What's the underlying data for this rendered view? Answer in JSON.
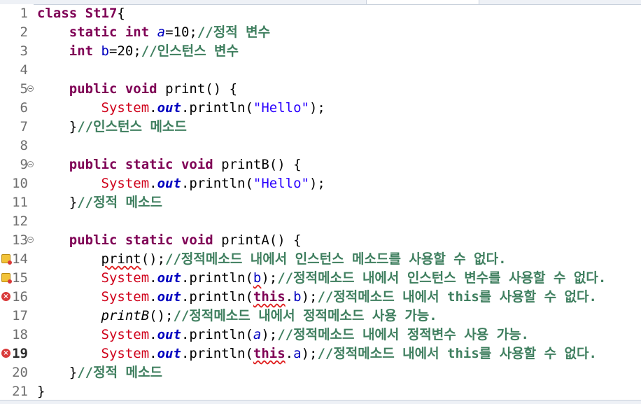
{
  "colors": {
    "keyword": "#7f0055",
    "string": "#2a00ff",
    "comment": "#3f7f5f",
    "system_class": "#d0021b",
    "static_field": "#0000c0",
    "error_marker": "#d93a3a",
    "warning_marker": "#f2c339"
  },
  "gutter": [
    {
      "num": "1",
      "marker": "",
      "fold": false
    },
    {
      "num": "2",
      "marker": "",
      "fold": false
    },
    {
      "num": "3",
      "marker": "",
      "fold": false
    },
    {
      "num": "4",
      "marker": "",
      "fold": false
    },
    {
      "num": "5",
      "marker": "",
      "fold": true
    },
    {
      "num": "6",
      "marker": "",
      "fold": false
    },
    {
      "num": "7",
      "marker": "",
      "fold": false
    },
    {
      "num": "8",
      "marker": "",
      "fold": false
    },
    {
      "num": "9",
      "marker": "",
      "fold": true
    },
    {
      "num": "10",
      "marker": "",
      "fold": false
    },
    {
      "num": "11",
      "marker": "",
      "fold": false
    },
    {
      "num": "12",
      "marker": "",
      "fold": false
    },
    {
      "num": "13",
      "marker": "",
      "fold": true
    },
    {
      "num": "14",
      "marker": "warning-icon",
      "fold": false
    },
    {
      "num": "15",
      "marker": "warning-icon",
      "fold": false
    },
    {
      "num": "16",
      "marker": "error-icon",
      "fold": false
    },
    {
      "num": "17",
      "marker": "",
      "fold": false
    },
    {
      "num": "18",
      "marker": "",
      "fold": false
    },
    {
      "num": "19",
      "marker": "error-icon",
      "fold": false,
      "highlight": true
    },
    {
      "num": "20",
      "marker": "",
      "fold": false
    },
    {
      "num": "21",
      "marker": "",
      "fold": false
    }
  ],
  "lines": [
    {
      "indent": "",
      "tokens": [
        {
          "t": "class",
          "c": "kw"
        },
        {
          "t": " "
        },
        {
          "t": "St17",
          "c": "cls"
        },
        {
          "t": "{"
        }
      ]
    },
    {
      "indent": "    ",
      "tokens": [
        {
          "t": "static",
          "c": "kw"
        },
        {
          "t": " "
        },
        {
          "t": "int",
          "c": "kw"
        },
        {
          "t": " "
        },
        {
          "t": "a",
          "c": "sfield"
        },
        {
          "t": "=10;"
        },
        {
          "t": "//정적 변수",
          "c": "cm"
        }
      ]
    },
    {
      "indent": "    ",
      "tokens": [
        {
          "t": "int",
          "c": "kw"
        },
        {
          "t": " "
        },
        {
          "t": "b",
          "c": "field"
        },
        {
          "t": "=20;"
        },
        {
          "t": "//인스턴스 변수",
          "c": "cm"
        }
      ]
    },
    {
      "indent": "",
      "tokens": []
    },
    {
      "indent": "    ",
      "tokens": [
        {
          "t": "public",
          "c": "kw"
        },
        {
          "t": " "
        },
        {
          "t": "void",
          "c": "kw"
        },
        {
          "t": " print() {"
        }
      ]
    },
    {
      "indent": "        ",
      "tokens": [
        {
          "t": "System",
          "c": "sys"
        },
        {
          "t": "."
        },
        {
          "t": "out",
          "c": "out"
        },
        {
          "t": ".println("
        },
        {
          "t": "\"Hello\"",
          "c": "str"
        },
        {
          "t": ");"
        }
      ]
    },
    {
      "indent": "    ",
      "tokens": [
        {
          "t": "}"
        },
        {
          "t": "//인스턴스 메소드",
          "c": "cm"
        }
      ]
    },
    {
      "indent": "",
      "tokens": []
    },
    {
      "indent": "    ",
      "tokens": [
        {
          "t": "public",
          "c": "kw"
        },
        {
          "t": " "
        },
        {
          "t": "static",
          "c": "kw"
        },
        {
          "t": " "
        },
        {
          "t": "void",
          "c": "kw"
        },
        {
          "t": " printB() {"
        }
      ]
    },
    {
      "indent": "        ",
      "tokens": [
        {
          "t": "System",
          "c": "sys"
        },
        {
          "t": "."
        },
        {
          "t": "out",
          "c": "out"
        },
        {
          "t": ".println("
        },
        {
          "t": "\"Hello\"",
          "c": "str"
        },
        {
          "t": ");"
        }
      ]
    },
    {
      "indent": "    ",
      "tokens": [
        {
          "t": "}"
        },
        {
          "t": "//정적 메소드",
          "c": "cm"
        }
      ]
    },
    {
      "indent": "",
      "tokens": []
    },
    {
      "indent": "    ",
      "tokens": [
        {
          "t": "public",
          "c": "kw"
        },
        {
          "t": " "
        },
        {
          "t": "static",
          "c": "kw"
        },
        {
          "t": " "
        },
        {
          "t": "void",
          "c": "kw"
        },
        {
          "t": " printA() {"
        }
      ]
    },
    {
      "indent": "        ",
      "tokens": [
        {
          "t": "print",
          "c": "err"
        },
        {
          "t": "();"
        },
        {
          "t": "//정적메소드 내에서 인스턴스 메소드를 사용할 수 없다.",
          "c": "cm"
        }
      ]
    },
    {
      "indent": "        ",
      "tokens": [
        {
          "t": "System",
          "c": "sys"
        },
        {
          "t": "."
        },
        {
          "t": "out",
          "c": "out"
        },
        {
          "t": ".println("
        },
        {
          "t": "b",
          "c": "err field"
        },
        {
          "t": ");"
        },
        {
          "t": "//정적메소드 내에서 인스턴스 변수를 사용할 수 없다.",
          "c": "cm"
        }
      ]
    },
    {
      "indent": "        ",
      "tokens": [
        {
          "t": "System",
          "c": "sys"
        },
        {
          "t": "."
        },
        {
          "t": "out",
          "c": "out"
        },
        {
          "t": ".println("
        },
        {
          "t": "this",
          "c": "kw err"
        },
        {
          "t": "."
        },
        {
          "t": "b",
          "c": "field"
        },
        {
          "t": ");"
        },
        {
          "t": "//정적메소드 내에서 this를 사용할 수 없다.",
          "c": "cm"
        }
      ]
    },
    {
      "indent": "        ",
      "tokens": [
        {
          "t": "printB",
          "c": "italic"
        },
        {
          "t": "();"
        },
        {
          "t": "//정적메소드 내에서 정적메소드 사용 가능.",
          "c": "cm"
        }
      ]
    },
    {
      "indent": "        ",
      "tokens": [
        {
          "t": "System",
          "c": "sys"
        },
        {
          "t": "."
        },
        {
          "t": "out",
          "c": "out"
        },
        {
          "t": ".println("
        },
        {
          "t": "a",
          "c": "sfield"
        },
        {
          "t": ");"
        },
        {
          "t": "//정적메소드 내에서 정적변수 사용 가능.",
          "c": "cm"
        }
      ]
    },
    {
      "indent": "        ",
      "tokens": [
        {
          "t": "System",
          "c": "sys"
        },
        {
          "t": "."
        },
        {
          "t": "out",
          "c": "out"
        },
        {
          "t": ".println("
        },
        {
          "t": "this",
          "c": "kw err"
        },
        {
          "t": "."
        },
        {
          "t": "a",
          "c": "field"
        },
        {
          "t": ");"
        },
        {
          "t": "//정적메소드 내에서 this를 사용할 수 없다.",
          "c": "cm"
        }
      ]
    },
    {
      "indent": "    ",
      "tokens": [
        {
          "t": "}"
        },
        {
          "t": "//정적 메소드",
          "c": "cm"
        }
      ]
    },
    {
      "indent": "",
      "tokens": [
        {
          "t": "}"
        }
      ]
    }
  ]
}
